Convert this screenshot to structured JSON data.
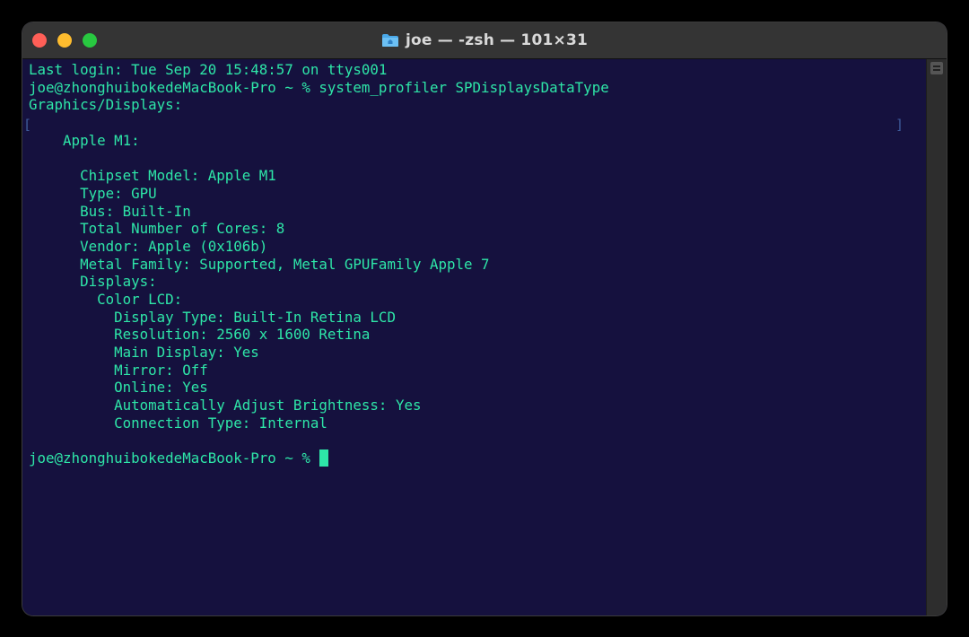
{
  "window": {
    "title": "joe — -zsh — 101×31",
    "folder_icon": "folder-icon",
    "colors": {
      "close": "#ff5f57",
      "minimize": "#febc2e",
      "maximize": "#28c840",
      "terminal_bg": "#15113e",
      "terminal_fg": "#2ee6a8"
    }
  },
  "terminal": {
    "lines": [
      "Last login: Tue Sep 20 15:48:57 on ttys001",
      "joe@zhonghuibokedeMacBook-Pro ~ % system_profiler SPDisplaysDataType",
      "Graphics/Displays:",
      "",
      "    Apple M1:",
      "",
      "      Chipset Model: Apple M1",
      "      Type: GPU",
      "      Bus: Built-In",
      "      Total Number of Cores: 8",
      "      Vendor: Apple (0x106b)",
      "      Metal Family: Supported, Metal GPUFamily Apple 7",
      "      Displays:",
      "        Color LCD:",
      "          Display Type: Built-In Retina LCD",
      "          Resolution: 2560 x 1600 Retina",
      "          Main Display: Yes",
      "          Mirror: Off",
      "          Online: Yes",
      "          Automatically Adjust Brightness: Yes",
      "          Connection Type: Internal",
      ""
    ],
    "prompt": "joe@zhonghuibokedeMacBook-Pro ~ % ",
    "bracket_left": "[",
    "bracket_right": "]"
  }
}
